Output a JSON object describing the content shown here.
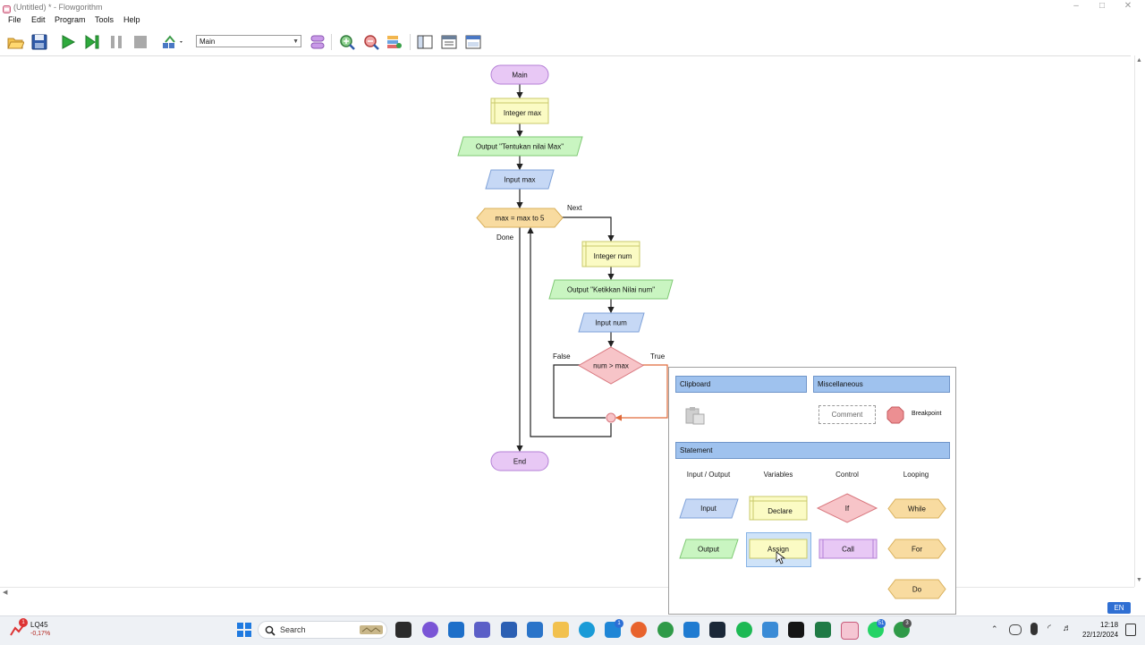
{
  "window": {
    "title": "(Untitled) * - Flowgorithm"
  },
  "menu": {
    "items": [
      "File",
      "Edit",
      "Program",
      "Tools",
      "Help"
    ]
  },
  "toolbar": {
    "function_select_value": "Main",
    "icons": [
      "open-folder-icon",
      "save-icon",
      "run-icon",
      "step-icon",
      "pause-icon",
      "stop-icon",
      "layout-icon",
      "function-manager-icon",
      "zoom-in-icon",
      "zoom-out-icon",
      "variable-watch-icon",
      "console-icon",
      "source-viewer-icon",
      "chart-panel-icon"
    ]
  },
  "flowchart": {
    "main_start": "Main",
    "declare_max": "Integer max",
    "output_prompt": "Output \"Tentukan nilai Max\"",
    "input_max": "Input max",
    "for_loop": "max = max to 5",
    "next_label": "Next",
    "done_label": "Done",
    "declare_num": "Integer num",
    "output_num_prompt": "Output \"Ketikkan Nilai num\"",
    "input_num": "Input num",
    "if_condition": "num > max",
    "false_label": "False",
    "true_label": "True",
    "end_label": "End"
  },
  "palette": {
    "clipboard_header": "Clipboard",
    "misc_header": "Miscellaneous",
    "comment_label": "Comment",
    "breakpoint_label": "Breakpoint",
    "statement_header": "Statement",
    "columns": [
      "Input / Output",
      "Variables",
      "Control",
      "Looping"
    ],
    "input": "Input",
    "output": "Output",
    "declare": "Declare",
    "assign": "Assign",
    "if": "If",
    "call": "Call",
    "while": "While",
    "for": "For",
    "do": "Do"
  },
  "colors": {
    "terminal_fill": "#e8c8f5",
    "declare_fill": "#fbfbc4",
    "output_fill": "#c9f5c1",
    "input_fill": "#c6d8f5",
    "loop_fill": "#f8dba0",
    "if_fill": "#f7c4c8",
    "header_blue": "#9fc2ee"
  },
  "taskbar": {
    "stock_name": "LQ45",
    "stock_change": "-0,17%",
    "search_placeholder": "Search",
    "notification_badge_1": "1",
    "notification_badge_2": "51",
    "notification_badge_3": "3",
    "lang": "EN",
    "time": "12:18",
    "date": "22/12/2024"
  }
}
